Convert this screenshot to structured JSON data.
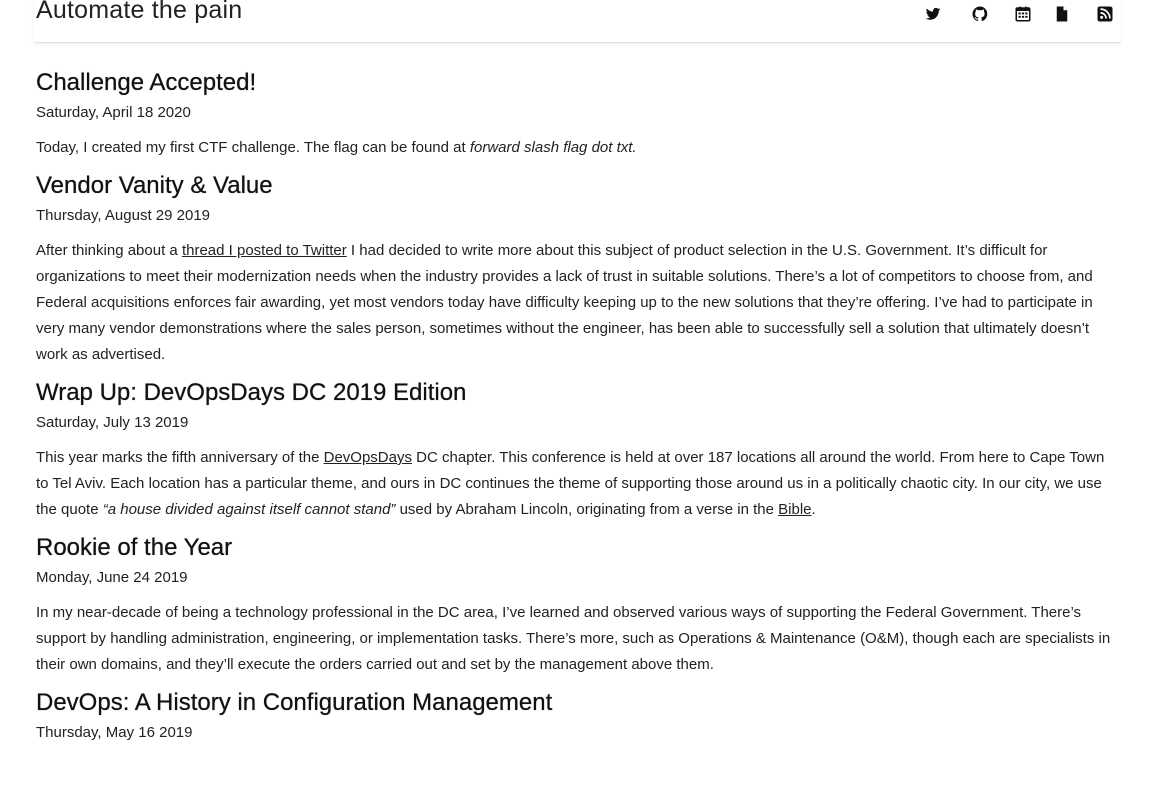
{
  "site": {
    "title": "Automate the pain"
  },
  "nav_icons": [
    {
      "name": "twitter-icon"
    },
    {
      "name": "github-icon"
    },
    {
      "name": "calendar-icon"
    },
    {
      "name": "document-icon"
    },
    {
      "name": "rss-icon"
    }
  ],
  "posts": [
    {
      "title": "Challenge Accepted!",
      "date": "Saturday, April 18 2020",
      "excerpt": [
        {
          "t": "Today, I created my first CTF challenge. The flag can be found at "
        },
        {
          "t": "forward slash flag dot txt.",
          "em": true
        }
      ]
    },
    {
      "title": "Vendor Vanity & Value",
      "date": "Thursday, August 29 2019",
      "excerpt": [
        {
          "t": "After thinking about a "
        },
        {
          "t": "thread I posted to Twitter",
          "link": true
        },
        {
          "t": " I had decided to write more about this subject of product selection in the U.S. Government. It’s difficult for organizations to meet their modernization needs when the industry provides a lack of trust in suitable solutions. There’s a lot of competitors to choose from, and Federal acquisitions enforces fair awarding, yet most vendors today have difficulty keeping up to the new solutions that they’re offering. I’ve had to participate in very many vendor demonstrations where the sales person, sometimes without the engineer, has been able to successfully sell a solution that ultimately doesn’t work as advertised."
        }
      ]
    },
    {
      "title": "Wrap Up: DevOpsDays DC 2019 Edition",
      "date": "Saturday, July 13 2019",
      "excerpt": [
        {
          "t": "This year marks the fifth anniversary of the "
        },
        {
          "t": "DevOpsDays",
          "link": true
        },
        {
          "t": " DC chapter. This conference is held at over 187 locations all around the world. From here to Cape Town to Tel Aviv. Each location has a particular theme, and ours in DC continues the theme of supporting those around us in a politically chaotic city. In our city, we use the quote "
        },
        {
          "t": "“a house divided against itself cannot stand”",
          "em": true
        },
        {
          "t": " used by Abraham Lincoln, originating from a verse in the "
        },
        {
          "t": "Bible",
          "link": true
        },
        {
          "t": "."
        }
      ]
    },
    {
      "title": "Rookie of the Year",
      "date": "Monday, June 24 2019",
      "excerpt": [
        {
          "t": "In my near-decade of being a technology professional in the DC area, I’ve learned and observed various ways of supporting the Federal Government. There’s support by handling administration, engineering, or implementation tasks. There’s more, such as Operations & Maintenance (O&M), though each are specialists in their own domains, and they’ll execute the orders carried out and set by the management above them."
        }
      ]
    },
    {
      "title": "DevOps: A History in Configuration Management",
      "date": "Thursday, May 16 2019",
      "excerpt": []
    }
  ]
}
